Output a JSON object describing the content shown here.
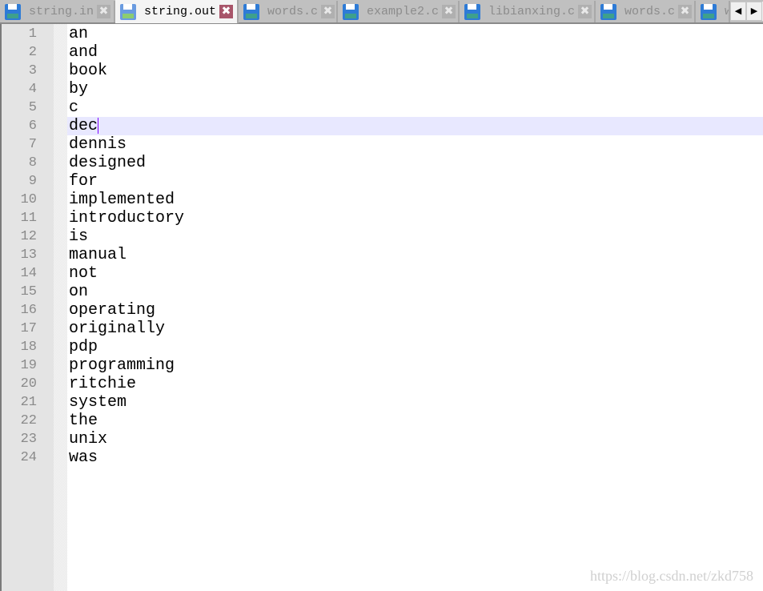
{
  "tabs": [
    {
      "label": "string.in",
      "active": false
    },
    {
      "label": "string.out",
      "active": true
    },
    {
      "label": "words.c",
      "active": false
    },
    {
      "label": "example2.c",
      "active": false
    },
    {
      "label": "libianxing.c",
      "active": false
    },
    {
      "label": "words.c",
      "active": false
    },
    {
      "label": "w",
      "active": false
    }
  ],
  "scroll": {
    "left": "◀",
    "right": "▶"
  },
  "close_glyph": "✖",
  "editor": {
    "current_line": 6,
    "lines": [
      "an",
      "and",
      "book",
      "by",
      "c",
      "dec",
      "dennis",
      "designed",
      "for",
      "implemented",
      "introductory",
      "is",
      "manual",
      "not",
      "on",
      "operating",
      "originally",
      "pdp",
      "programming",
      "ritchie",
      "system",
      "the",
      "unix",
      "was"
    ]
  },
  "watermark": "https://blog.csdn.net/zkd758",
  "colors": {
    "current_line": "#e8e8ff",
    "caret": "#8000ff",
    "active_close": "#a8556a"
  }
}
